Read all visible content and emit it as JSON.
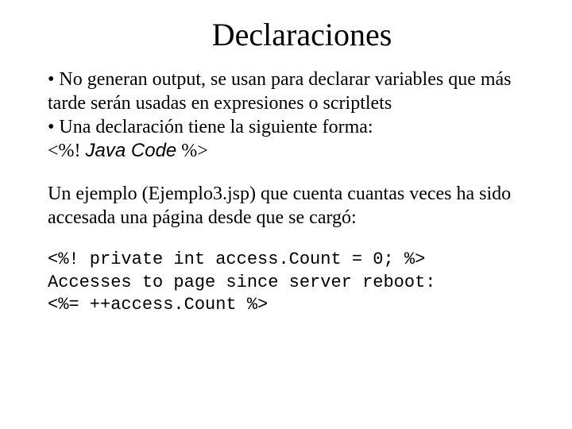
{
  "title": "Declaraciones",
  "bullets": {
    "b1": "• No generan output, se usan para declarar variables que más tarde serán usadas en expresiones o scriptlets",
    "b2": "• Una declaración tiene la siguiente forma:",
    "decl_open": "<%! ",
    "decl_mid": "Java Code",
    "decl_close": " %>"
  },
  "example_intro": "Un ejemplo (Ejemplo3.jsp) que cuenta cuantas veces ha sido accesada una página desde que se cargó:",
  "code": {
    "l1": "<%! private int access.Count = 0; %>",
    "l2": "Accesses to page since server reboot:",
    "l3": "<%= ++access.Count %>"
  }
}
